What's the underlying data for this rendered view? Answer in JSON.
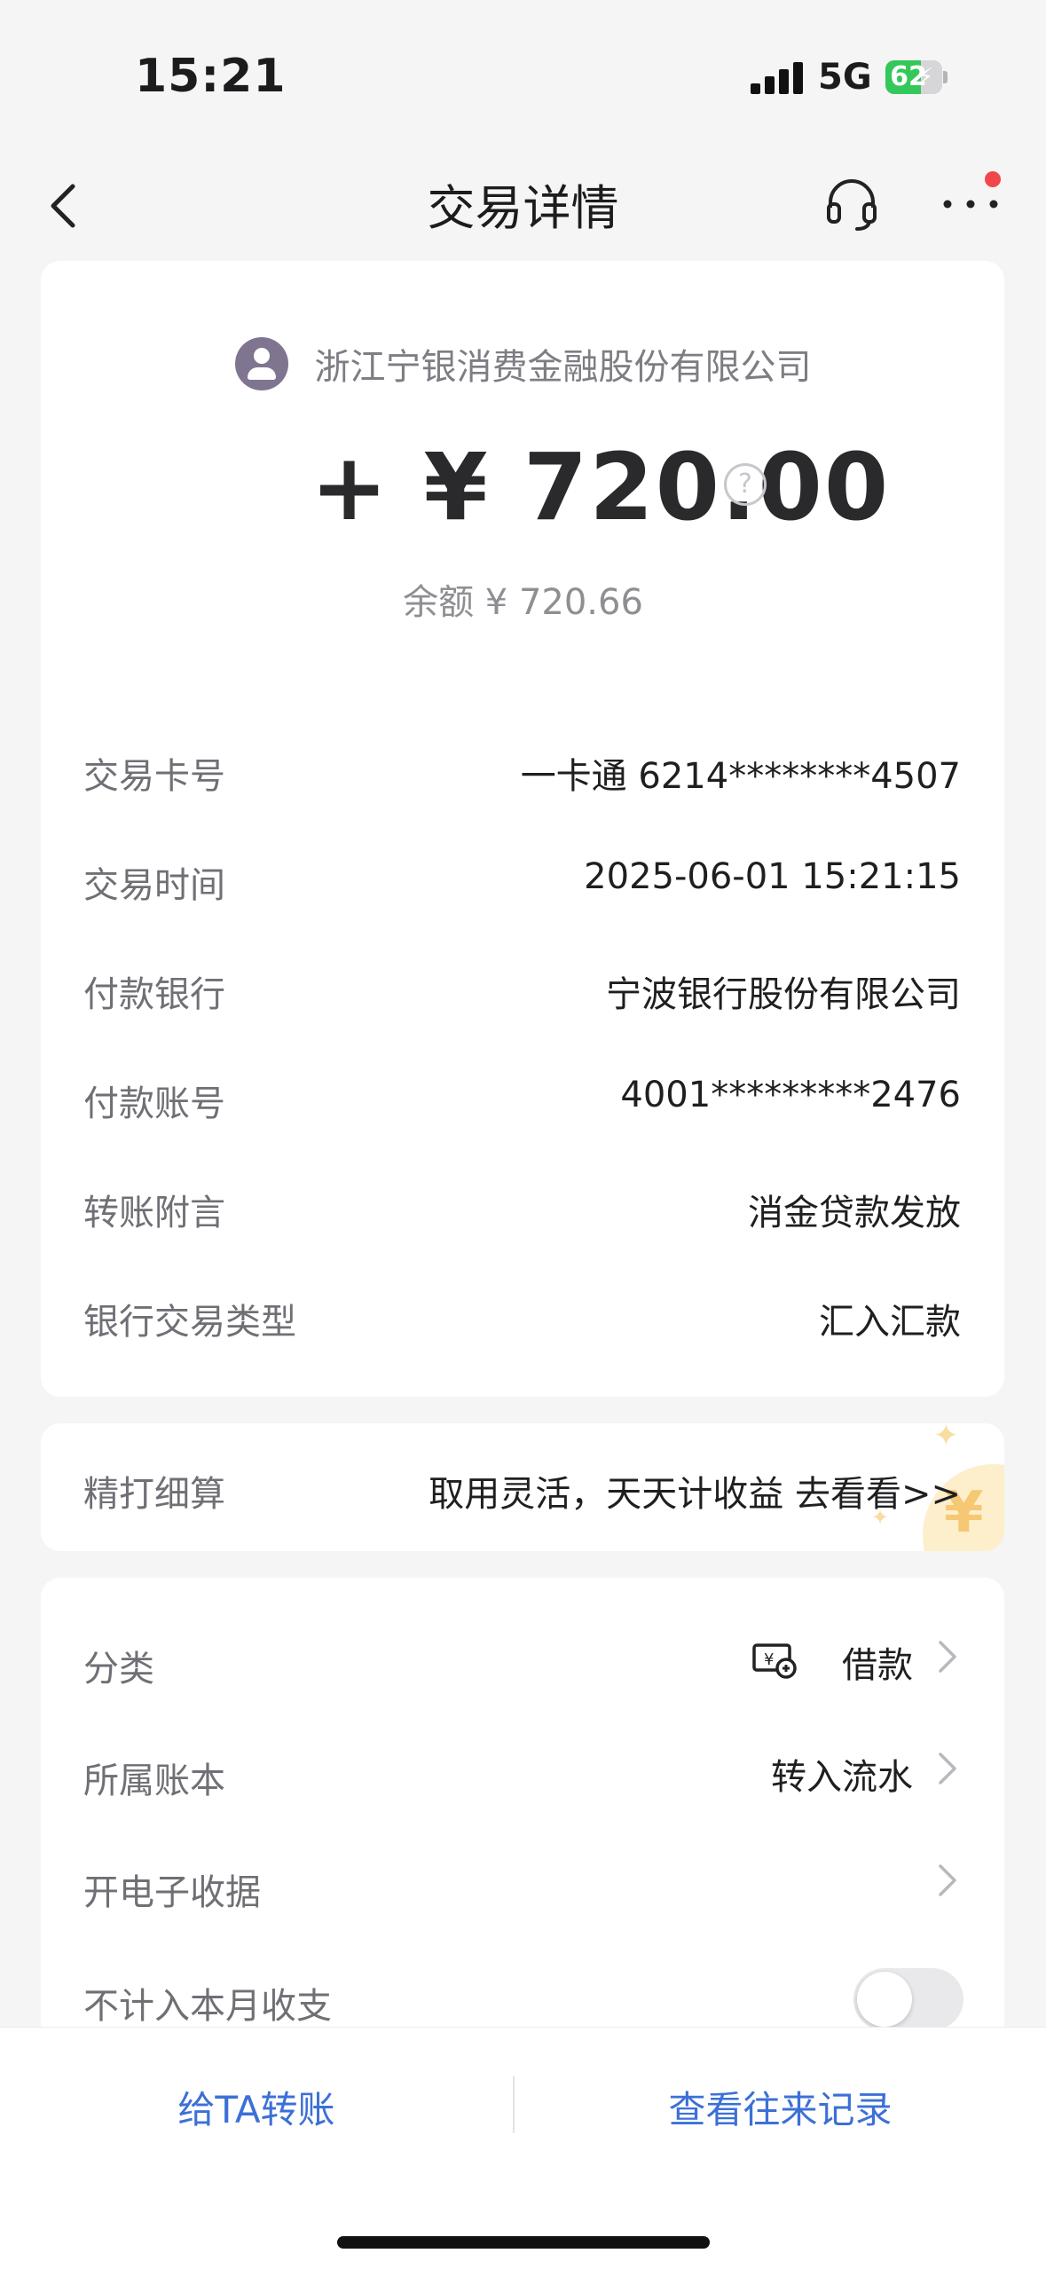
{
  "status": {
    "time": "15:21",
    "network": "5G",
    "battery": "62",
    "battery_level": 0.62,
    "battery_color": "#34c759",
    "bolt_glyph": "⚡"
  },
  "nav": {
    "back_icon": "chevron-left-icon",
    "title": "交易详情",
    "service_icon": "headset-icon",
    "more_icon": "more-dots-icon"
  },
  "detail": {
    "merchant": "浙江宁银消费金融股份有限公司",
    "amount": "+ ¥ 720.00",
    "help_glyph": "?",
    "balance": "余额 ¥ 720.66",
    "rows": [
      {
        "label": "交易卡号",
        "value": "一卡通 6214********4507"
      },
      {
        "label": "交易时间",
        "value": "2025-06-01 15:21:15"
      },
      {
        "label": "付款银行",
        "value": "宁波银行股份有限公司"
      },
      {
        "label": "付款账号",
        "value": "4001*********2476"
      },
      {
        "label": "转账附言",
        "value": "消金贷款发放"
      },
      {
        "label": "银行交易类型",
        "value": "汇入汇款"
      }
    ]
  },
  "promo": {
    "label": "精打细算",
    "text": "取用灵活，天天计收益 去看看>>",
    "coin_glyph": "¥",
    "sparkle_glyph": "✦"
  },
  "settings": {
    "category_label": "分类",
    "category_value": "借款",
    "category_icon": "loan-icon",
    "ledger_label": "所属账本",
    "ledger_value": "转入流水",
    "receipt_label": "开电子收据",
    "exclude_label": "不计入本月收支",
    "exclude_on": false
  },
  "actions": {
    "transfer": "给TA转账",
    "history": "查看往来记录"
  },
  "colors": {
    "accent": "#3c70d6",
    "alert": "#f2474a",
    "page_bg": "#f5f5f6"
  }
}
